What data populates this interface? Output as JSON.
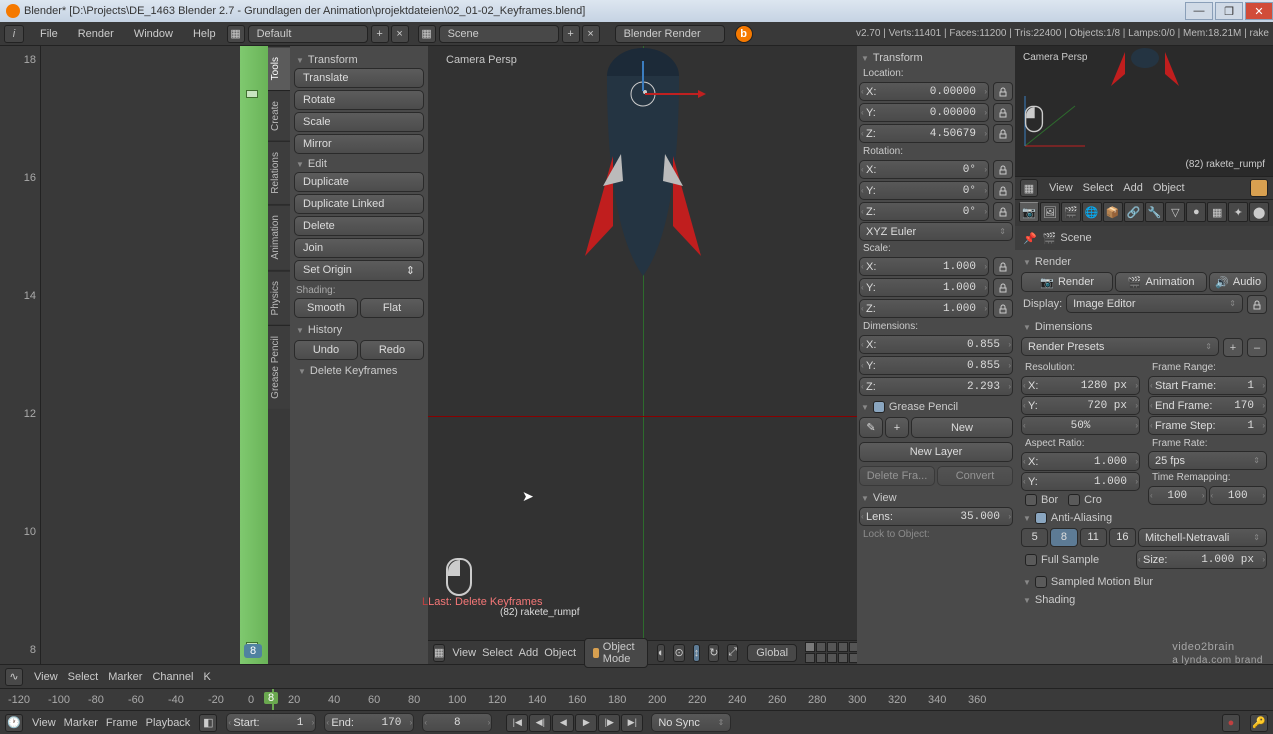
{
  "window": {
    "title": "Blender* [D:\\Projects\\DE_1463 Blender 2.7 - Grundlagen der Animation\\projektdateien\\02_01-02_Keyframes.blend]"
  },
  "menubar": {
    "items": [
      "File",
      "Render",
      "Window",
      "Help"
    ],
    "layout": "Default",
    "scene": "Scene",
    "engine": "Blender Render",
    "stats": "v2.70 | Verts:11401 | Faces:11200 | Tris:22400 | Objects:1/8 | Lamps:0/0 | Mem:18.21M | rake"
  },
  "toolshelf": {
    "tabs": [
      "Tools",
      "Create",
      "Relations",
      "Animation",
      "Physics",
      "Grease Pencil"
    ],
    "transform_hd": "Transform",
    "translate": "Translate",
    "rotate": "Rotate",
    "scale": "Scale",
    "mirror": "Mirror",
    "edit_hd": "Edit",
    "duplicate": "Duplicate",
    "duplicate_linked": "Duplicate Linked",
    "delete": "Delete",
    "join": "Join",
    "set_origin": "Set Origin",
    "shading_hd": "Shading:",
    "smooth": "Smooth",
    "flat": "Flat",
    "history_hd": "History",
    "undo": "Undo",
    "redo": "Redo",
    "last_op_panel": "Delete Keyframes"
  },
  "viewport": {
    "persp": "Camera Persp",
    "last_op": "Last: Delete Keyframes",
    "obj_info": "(82) rakete_rumpf",
    "header_menus": [
      "View",
      "Select",
      "Add",
      "Object"
    ],
    "mode": "Object Mode",
    "orientation": "Global"
  },
  "npanel": {
    "transform_hd": "Transform",
    "location_lbl": "Location:",
    "loc_x": "0.00000",
    "loc_y": "0.00000",
    "loc_z": "4.50679",
    "rotation_lbl": "Rotation:",
    "rot_x": "0°",
    "rot_y": "0°",
    "rot_z": "0°",
    "rot_mode": "XYZ Euler",
    "scale_lbl": "Scale:",
    "scl_x": "1.000",
    "scl_y": "1.000",
    "scl_z": "1.000",
    "dim_lbl": "Dimensions:",
    "dim_x": "0.855",
    "dim_y": "0.855",
    "dim_z": "2.293",
    "gp_hd": "Grease Pencil",
    "gp_new": "New",
    "gp_new_layer": "New Layer",
    "gp_delete": "Delete Fra...",
    "gp_convert": "Convert",
    "view_hd": "View",
    "lens_lbl": "Lens:",
    "lens_val": "35.000",
    "lock_lbl": "Lock to Object:"
  },
  "mini": {
    "persp": "Camera Persp",
    "objn": "(82) rakete_rumpf",
    "menus": [
      "View",
      "Select",
      "Add",
      "Object"
    ]
  },
  "outliner": {
    "scene": "Scene"
  },
  "render": {
    "section": "Render",
    "render": "Render",
    "anim": "Animation",
    "audio": "Audio",
    "display_lbl": "Display:",
    "display_val": "Image Editor",
    "dim_hd": "Dimensions",
    "presets": "Render Presets",
    "res_lbl": "Resolution:",
    "fr_lbl": "Frame Range:",
    "res_x": "1280 px",
    "res_y": "720 px",
    "res_pct": "50%",
    "start": "Start Frame:",
    "start_v": "1",
    "end": "End Frame:",
    "end_v": "170",
    "step": "Frame Step:",
    "step_v": "1",
    "ar_lbl": "Aspect Ratio:",
    "fr_rate_lbl": "Frame Rate:",
    "ar_x": "1.000",
    "ar_y": "1.000",
    "fps": "25 fps",
    "remap_lbl": "Time Remapping:",
    "remap_old": "100",
    "remap_new": "100",
    "border": "Bor",
    "crop": "Cro",
    "aa_hd": "Anti-Aliasing",
    "aa_5": "5",
    "aa_8": "8",
    "aa_11": "11",
    "aa_16": "16",
    "aa_filter": "Mitchell-Netravali",
    "full": "Full Sample",
    "size_lbl": "Size:",
    "size_v": "1.000 px",
    "smb_hd": "Sampled Motion Blur",
    "shading_hd": "Shading"
  },
  "dopesheet": {
    "menus": [
      "View",
      "Select",
      "Marker",
      "Channel",
      "K"
    ],
    "curframe": "8",
    "ticks_left": [
      "18",
      "16",
      "14",
      "12",
      "10",
      "8"
    ]
  },
  "ruler_ticks": [
    "-120",
    "-100",
    "-80",
    "-60",
    "-40",
    "-20",
    "0",
    "20",
    "40",
    "60",
    "80",
    "100",
    "120",
    "140",
    "160",
    "180",
    "200",
    "220",
    "240",
    "260",
    "280",
    "300",
    "320",
    "340",
    "360"
  ],
  "timeline": {
    "menus": [
      "View",
      "Marker",
      "Frame",
      "Playback"
    ],
    "start_lbl": "Start:",
    "start_v": "1",
    "end_lbl": "End:",
    "end_v": "170",
    "cur_v": "8",
    "sync": "No Sync"
  },
  "watermark": {
    "main": "video2brain",
    "sub": "a lynda.com brand"
  }
}
